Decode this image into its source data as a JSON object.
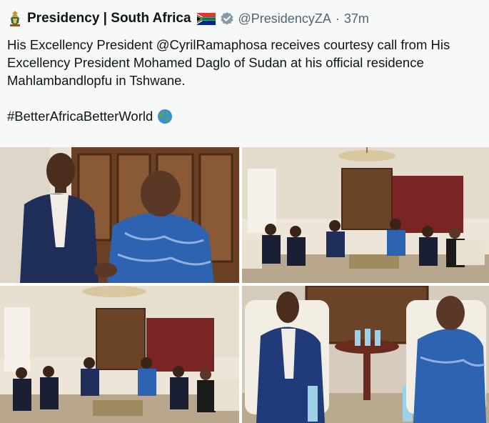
{
  "tweet": {
    "display_name": "Presidency | South Africa",
    "handle": "@PresidencyZA",
    "separator": "·",
    "time": "37m",
    "text": "His Excellency President @CyrilRamaphosa receives courtesy call  from His Excellency President Mohamed Daglo of Sudan at his official residence Mahlambandlopfu in Tshwane.",
    "hashtag": "#BetterAfricaBetterWorld"
  },
  "icons": {
    "avatar": "south-africa-coat-of-arms",
    "flag": "south-africa-flag",
    "verified": "verified-badge",
    "globe": "earth-globe-emoji"
  },
  "colors": {
    "text": "#0f1419",
    "muted": "#536471",
    "verified": "#829aab"
  },
  "media": {
    "photo_count": 4
  }
}
